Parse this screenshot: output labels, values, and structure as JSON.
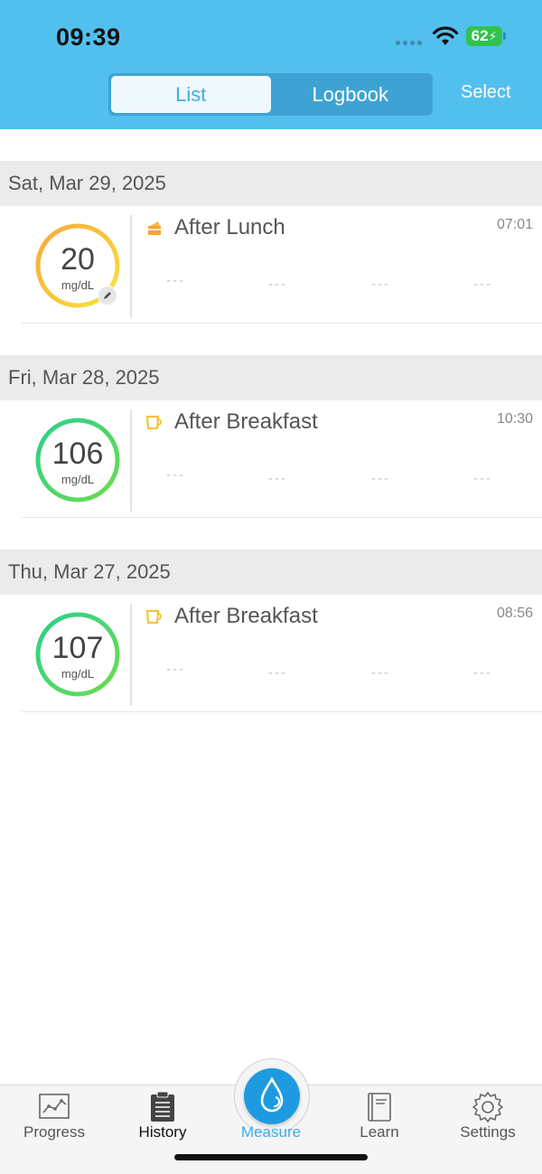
{
  "status": {
    "time": "09:39",
    "battery": "62"
  },
  "header": {
    "tabs": [
      {
        "label": "List",
        "active": true
      },
      {
        "label": "Logbook",
        "active": false
      }
    ],
    "select_label": "Select"
  },
  "days": [
    {
      "date": "Sat, Mar 29, 2025",
      "entries": [
        {
          "value": "20",
          "unit": "mg/dL",
          "meal": "After Lunch",
          "meal_icon": "cake-icon",
          "time": "07:01",
          "placeholders": [
            "---",
            "---",
            "---",
            "---"
          ],
          "ring_color": "#f6c43c",
          "edited": true
        }
      ]
    },
    {
      "date": "Fri, Mar 28, 2025",
      "entries": [
        {
          "value": "106",
          "unit": "mg/dL",
          "meal": "After Breakfast",
          "meal_icon": "cup-icon",
          "time": "10:30",
          "placeholders": [
            "---",
            "---",
            "---",
            "---"
          ],
          "ring_color": "#3ed37e",
          "edited": false
        }
      ]
    },
    {
      "date": "Thu, Mar 27, 2025",
      "entries": [
        {
          "value": "107",
          "unit": "mg/dL",
          "meal": "After Breakfast",
          "meal_icon": "cup-icon",
          "time": "08:56",
          "placeholders": [
            "---",
            "---",
            "---",
            "---"
          ],
          "ring_color": "#3ed37e",
          "edited": false
        }
      ]
    }
  ],
  "tabbar": {
    "items": [
      {
        "label": "Progress",
        "icon": "chart-icon"
      },
      {
        "label": "History",
        "icon": "clipboard-icon",
        "selected": true
      },
      {
        "label": "Measure",
        "icon": "drop-icon"
      },
      {
        "label": "Learn",
        "icon": "book-icon"
      },
      {
        "label": "Settings",
        "icon": "gear-icon"
      }
    ]
  }
}
